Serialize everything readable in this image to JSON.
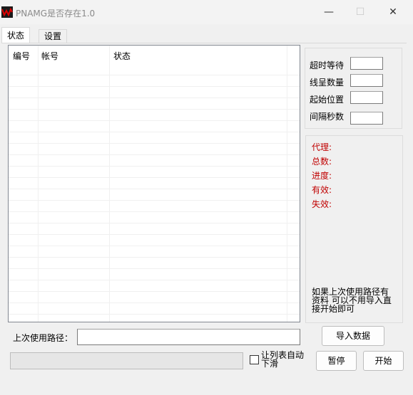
{
  "window": {
    "title": "PNAMG是否存在1.0",
    "icon": "app-w-logo-icon",
    "controls": {
      "minimize": "—",
      "maximize": "☐",
      "close": "✕"
    }
  },
  "tabs": [
    {
      "label": "状态",
      "active": true
    },
    {
      "label": "设置",
      "active": false
    }
  ],
  "list": {
    "columns": [
      "编号",
      "帐号",
      "状态"
    ],
    "rows": []
  },
  "settings": {
    "timeout_label": "超时等待",
    "timeout_value": "",
    "threads_label": "线呈数量",
    "threads_value": "",
    "start_label": "起始位置",
    "start_value": "",
    "interval_label": "间隔秒数",
    "interval_value": ""
  },
  "status": {
    "proxy": "代理:",
    "total": "总数:",
    "progress": "进度:",
    "valid": "有效:",
    "invalid": "失效:",
    "color": "#c00000"
  },
  "hint": "如果上次使用路径有资料 可以不用导入直接开始即可",
  "bottom": {
    "path_label": "上次使用路径：",
    "path_value": "",
    "import_button": "导入数据",
    "pause_button": "暂停",
    "start_button": "开始",
    "autoscroll_label": "让列表自动下滑",
    "autoscroll_checked": false,
    "progress_fraction": 0
  }
}
